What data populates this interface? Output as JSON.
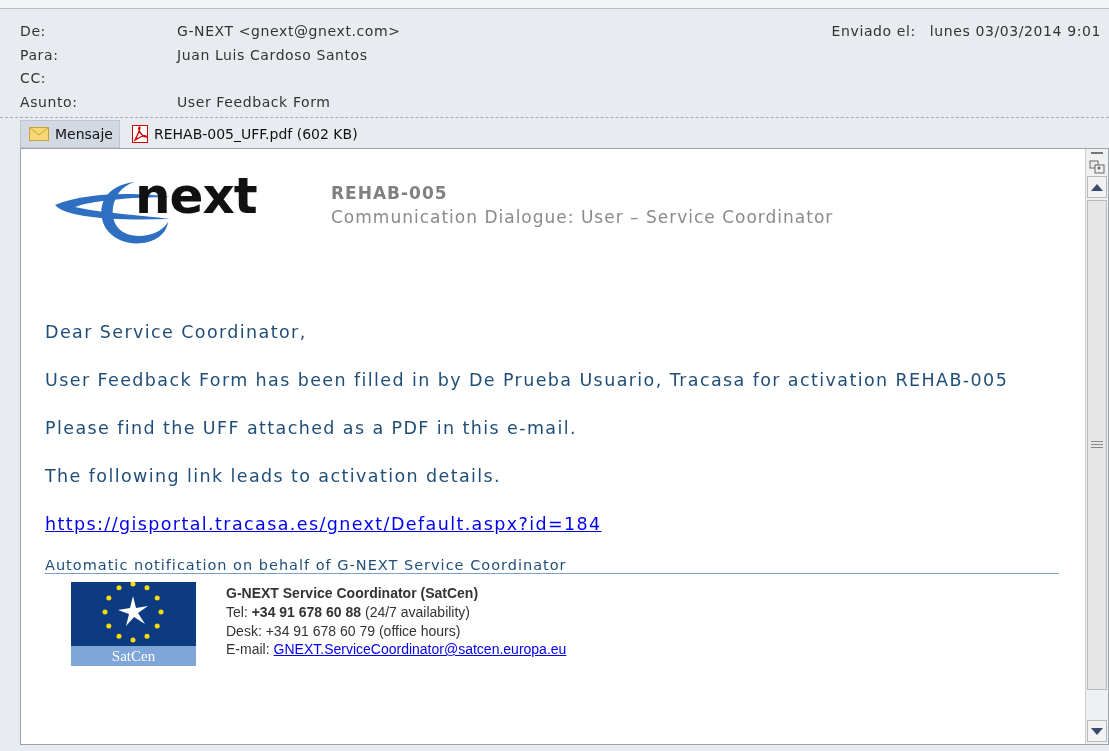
{
  "header": {
    "fields": [
      {
        "label": "De:",
        "value": "G-NEXT <gnext@gnext.com>"
      },
      {
        "label": "Para:",
        "value": "Juan Luis Cardoso Santos"
      },
      {
        "label": "CC:"
      },
      {
        "label": "Asunto:",
        "value": "User Feedback Form"
      }
    ],
    "sent": {
      "label": "Enviado el:",
      "value": "lunes 03/03/2014 9:01"
    }
  },
  "tabs": [
    {
      "kind": "message",
      "label": "Mensaje",
      "selected": true
    },
    {
      "kind": "pdf",
      "label": "REHAB-005_UFF.pdf (602 KB)",
      "selected": false
    }
  ],
  "body": {
    "logo_text": "next",
    "code": "REHAB-005",
    "subtitle": "Communication Dialogue: User – Service Coordinator",
    "paragraphs": [
      "Dear Service Coordinator,",
      "User Feedback Form has been filled in by De Prueba Usuario, Tracasa for activation REHAB-005",
      "Please find the UFF attached as a PDF in this e-mail.",
      "The following link leads to activation details."
    ],
    "link": "https://gisportal.tracasa.es/gnext/Default.aspx?id=184",
    "footer_note": "Automatic notification on behalf of G-NEXT Service Coordinator",
    "signature": {
      "emblem_text": "SatCen",
      "lines": [
        "**G-NEXT Service Coordinator (SatCen)**",
        "Tel: **+34 91 678 60 88** (24/7 availability)",
        "Desk: +34 91 678 60 79 (office hours)"
      ],
      "email_label": "E-mail:",
      "email": "GNEXT.ServiceCoordinator@satcen.europa.eu"
    }
  }
}
